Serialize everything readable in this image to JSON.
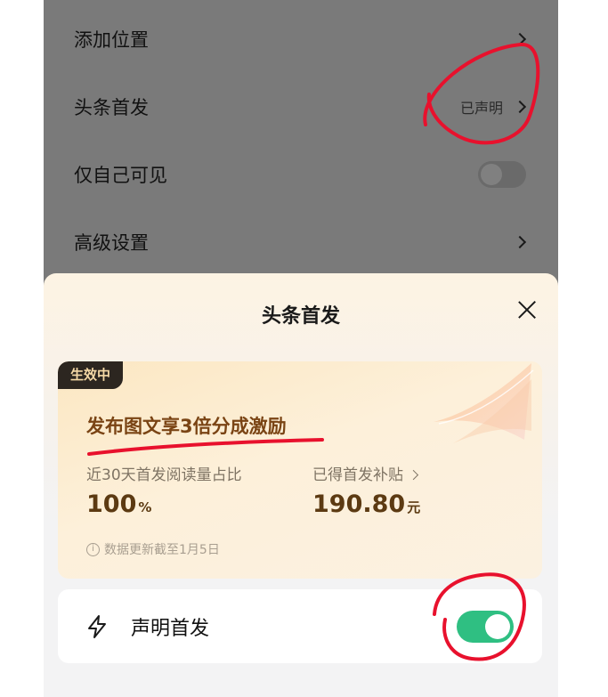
{
  "settings": {
    "items": [
      {
        "label": "添加位置"
      },
      {
        "label": "头条首发",
        "value": "已声明"
      },
      {
        "label": "仅自己可见",
        "toggle_on": false
      },
      {
        "label": "高级设置"
      }
    ]
  },
  "sheet": {
    "title": "头条首发",
    "badge": "生效中",
    "headline": "发布图文享3倍分成激励",
    "stats": [
      {
        "label": "近30天首发阅读量占比",
        "value": "100",
        "unit": "%"
      },
      {
        "label": "已得首发补贴",
        "value": "190.80",
        "unit": "元"
      }
    ],
    "update_note": "数据更新截至1月5日",
    "declare": {
      "label": "声明首发",
      "toggle_on": true
    }
  },
  "colors": {
    "toggle_on": "#2fbf82",
    "annotation": "#e8112d",
    "headline": "#7a4414"
  }
}
